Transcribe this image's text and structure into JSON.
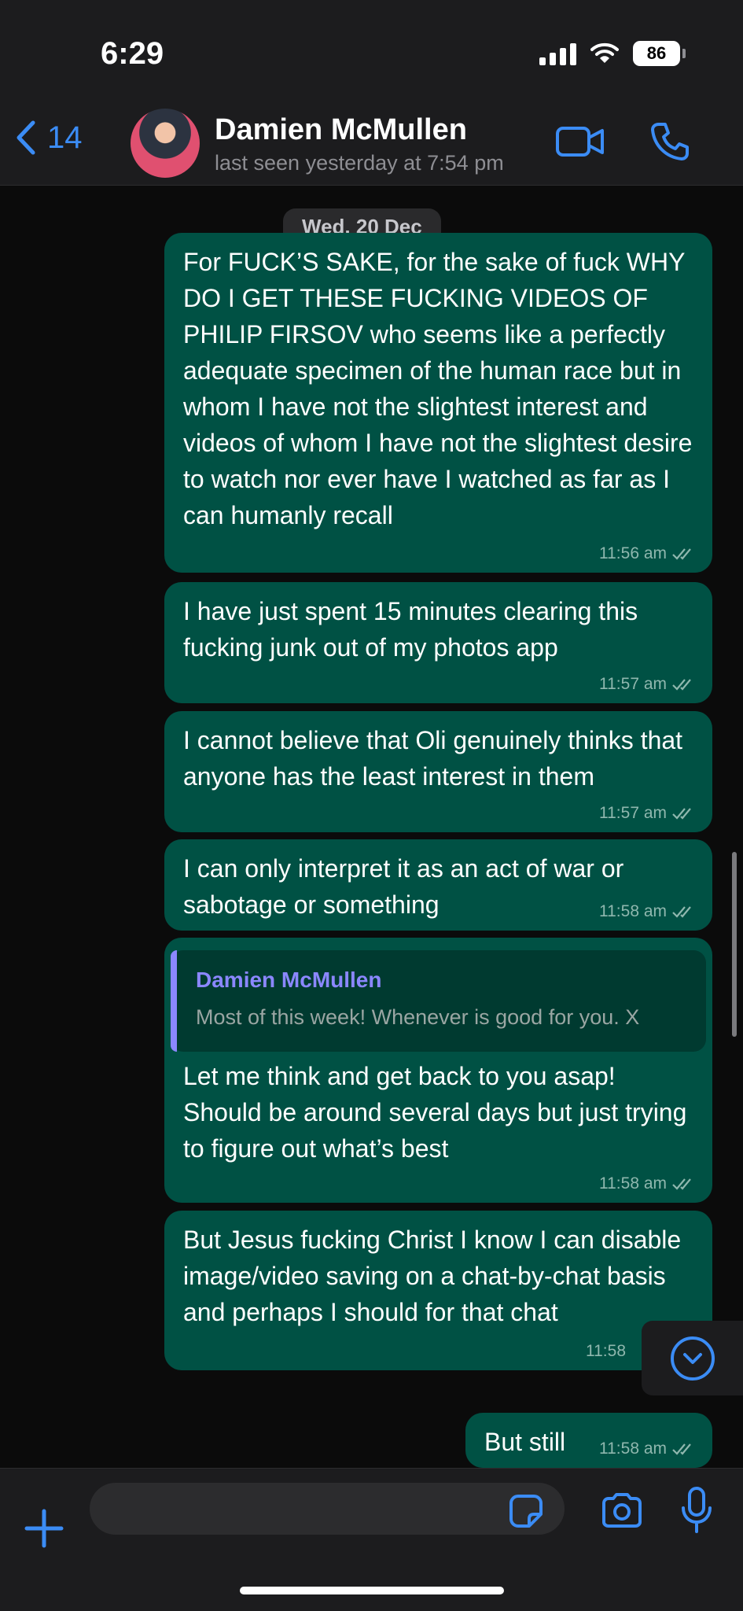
{
  "status_bar": {
    "time": "6:29",
    "battery": "86"
  },
  "header": {
    "back_count": "14",
    "contact_name": "Damien McMullen",
    "last_seen": "last seen yesterday at 7:54 pm"
  },
  "chat": {
    "date_label": "Wed, 20 Dec",
    "messages": [
      {
        "text": "For FUCK’S SAKE, for the sake of fuck WHY DO I GET THESE FUCKING VIDEOS OF PHILIP FIRSOV who seems like a perfectly adequate specimen of the human race but in whom I have not the slightest interest and videos of whom I have not the slightest desire to watch nor ever have I watched as far as I can humanly recall",
        "time": "11:56 am"
      },
      {
        "text": "I have just spent 15 minutes clearing this fucking junk out of my photos app",
        "time": "11:57 am"
      },
      {
        "text": "I cannot believe that Oli genuinely thinks that anyone has the least interest in them",
        "time": "11:57 am"
      },
      {
        "text": "I can only interpret it as an act of war or sabotage or something",
        "time": "11:58 am"
      },
      {
        "quote_name": "Damien McMullen",
        "quote_text": "Most of this week! Whenever is good for you. X",
        "text": "Let me think and get back to you asap! Should be around several days but just trying to figure out what’s best",
        "time": "11:58 am"
      },
      {
        "text": "But Jesus fucking Christ I know I can disable image/video saving on a chat-by-chat basis and perhaps I should for that chat",
        "time": "11:58"
      },
      {
        "text": "But still",
        "time": "11:58 am"
      }
    ]
  },
  "input": {
    "placeholder": ""
  },
  "colors": {
    "accent": "#3b8cf5",
    "outgoing_bubble": "#005144",
    "quote_accent": "#8b87ff"
  }
}
